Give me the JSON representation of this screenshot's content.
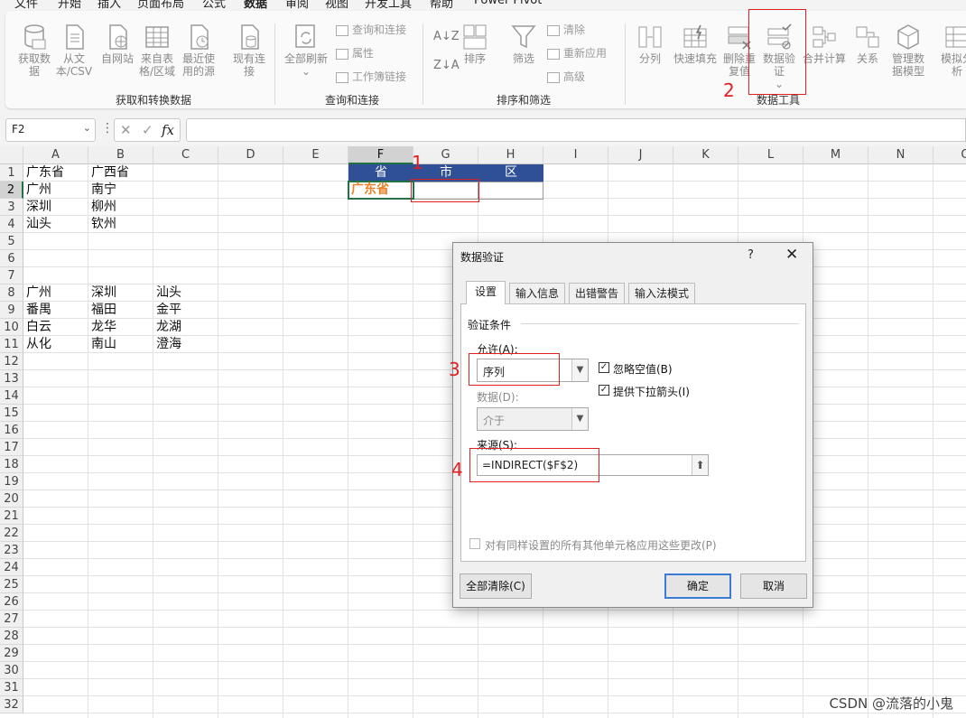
{
  "menu": {
    "items": [
      "文件",
      "开始",
      "插入",
      "页面布局",
      "公式",
      "数据",
      "审阅",
      "视图",
      "开发工具",
      "帮助",
      "Power Pivot"
    ],
    "active_index": 5
  },
  "ribbon": {
    "group1": {
      "buttons": [
        "获取数据",
        "从文本/CSV",
        "自网站",
        "来自表格/区域",
        "最近使用的源",
        "现有连接"
      ],
      "label": "获取和转换数据"
    },
    "group2": {
      "refresh": "全部刷新",
      "small": [
        "查询和连接",
        "属性",
        "工作簿链接"
      ],
      "label": "查询和连接"
    },
    "group3": {
      "sort": "排序",
      "filter": "筛选",
      "small": [
        "清除",
        "重新应用",
        "高级"
      ],
      "label": "排序和筛选"
    },
    "group4": {
      "buttons": [
        "分列",
        "快速填充",
        "删除重复值",
        "数据验证",
        "合并计算",
        "关系",
        "管理数据模型",
        "模拟分析"
      ],
      "label": "数据工具"
    }
  },
  "formula_bar": {
    "name_box": "F2",
    "fx": "fx",
    "formula": ""
  },
  "sheet": {
    "columns": [
      "A",
      "B",
      "C",
      "D",
      "E",
      "F",
      "G",
      "H",
      "I",
      "J",
      "K",
      "L",
      "M",
      "N",
      "O"
    ],
    "rows": [
      "1",
      "2",
      "3",
      "4",
      "5",
      "6",
      "7",
      "8",
      "9",
      "10",
      "11",
      "12",
      "13",
      "14",
      "15",
      "16",
      "17",
      "18",
      "19",
      "20",
      "21",
      "22",
      "23",
      "24",
      "25",
      "26",
      "27",
      "28",
      "29",
      "30",
      "31",
      "32"
    ],
    "cells": {
      "A1": "广东省",
      "B1": "广西省",
      "A2": "广州",
      "B2": "南宁",
      "A3": "深圳",
      "B3": "柳州",
      "A4": "汕头",
      "B4": "钦州",
      "A8": "广州",
      "B8": "深圳",
      "C8": "汕头",
      "A9": "番禺",
      "B9": "福田",
      "C9": "金平",
      "A10": "白云",
      "B10": "龙华",
      "C10": "龙湖",
      "A11": "从化",
      "B11": "南山",
      "C11": "澄海",
      "F1": "省",
      "G1": "市",
      "H1": "区",
      "F2": "广东省"
    },
    "header_fill": "#2f4f96",
    "accent_text": "#e8822a"
  },
  "annotations": [
    "1",
    "2",
    "3",
    "4"
  ],
  "dialog": {
    "title": "数据验证",
    "help": "?",
    "close": "✕",
    "tabs": [
      "设置",
      "输入信息",
      "出错警告",
      "输入法模式"
    ],
    "section": "验证条件",
    "allow_label": "允许(A):",
    "allow_value": "序列",
    "ignore_blank": "忽略空值(B)",
    "ignore_blank_checked": true,
    "dropdown_arrow": "提供下拉箭头(I)",
    "dropdown_arrow_checked": true,
    "data_label": "数据(D):",
    "data_value": "介于",
    "source_label": "来源(S):",
    "source_value": "=INDIRECT($F$2)",
    "apply_all": "对有同样设置的所有其他单元格应用这些更改(P)",
    "apply_all_checked": false,
    "clear_all": "全部清除(C)",
    "ok": "确定",
    "cancel": "取消"
  },
  "watermark": "CSDN @流落的小鬼"
}
